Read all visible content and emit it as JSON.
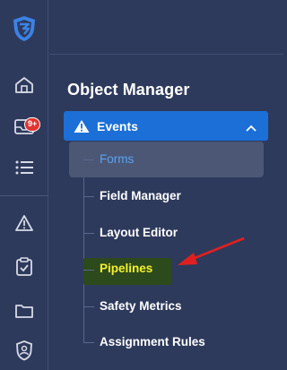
{
  "rail": {
    "badge": "9+",
    "icons": [
      "shield-logo-icon",
      "home-icon",
      "inbox-icon",
      "list-icon",
      "alert-triangle-icon",
      "clipboard-check-icon",
      "folder-icon",
      "shield-user-icon"
    ]
  },
  "object_manager": {
    "title": "Object Manager",
    "section": {
      "label": "Events",
      "expanded": true,
      "items": [
        {
          "label": "Forms",
          "selected": true
        },
        {
          "label": "Field Manager"
        },
        {
          "label": "Layout Editor"
        },
        {
          "label": "Pipelines",
          "highlighted": true
        },
        {
          "label": "Safety Metrics"
        },
        {
          "label": "Assignment Rules"
        }
      ]
    }
  },
  "colors": {
    "background": "#2e3a5c",
    "accent": "#1b6fd6",
    "selected_text": "#5ba3f0",
    "highlight_text": "#f3f32a",
    "annotation_arrow": "#e02020"
  }
}
